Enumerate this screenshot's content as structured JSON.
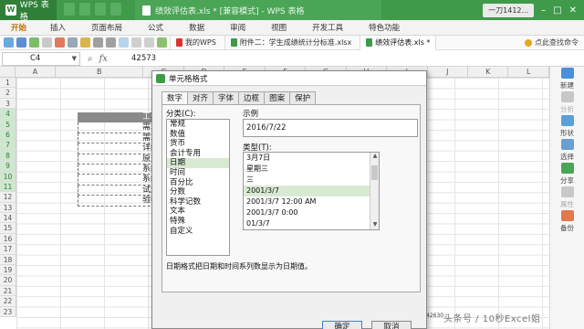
{
  "titlebar": {
    "app_name": "WPS 表格",
    "doc_title": "绩效评估表.xls * [兼容模式] - WPS 表格",
    "user": "一刀1412..."
  },
  "ribbon": {
    "tabs": [
      "开始",
      "插入",
      "页面布局",
      "公式",
      "数据",
      "审阅",
      "视图",
      "开发工具",
      "特色功能"
    ]
  },
  "doc_tabs": [
    {
      "label": "我的WPS"
    },
    {
      "label": "附件二：学生成绩统计分标准.xlsx"
    },
    {
      "label": "绩效评估表.xls *"
    }
  ],
  "search_hint": "点此查找命令",
  "formula": {
    "cell_ref": "C4",
    "value": "42573"
  },
  "columns": [
    "A",
    "B",
    "C",
    "D",
    "E",
    "F",
    "G",
    "H",
    "I",
    "J",
    "K",
    "L"
  ],
  "rows": [
    "1",
    "2",
    "3",
    "4",
    "5",
    "6",
    "7",
    "8",
    "9",
    "10",
    "11",
    "12",
    "13",
    "14",
    "15",
    "16",
    "17",
    "18",
    "19",
    "20",
    "21",
    "22",
    "23"
  ],
  "sheet": {
    "header_text": "工作任",
    "cells": [
      "需求调",
      "需求分",
      "详细分",
      "原型制",
      "系统开",
      "系统测",
      "试运行",
      "验收及"
    ],
    "stray_value": "42630"
  },
  "taskpane": {
    "items": [
      "新建",
      "分析",
      "形状",
      "选择",
      "分享",
      "属性",
      "备份"
    ]
  },
  "dialog": {
    "title": "单元格格式",
    "tabs": [
      "数字",
      "对齐",
      "字体",
      "边框",
      "图案",
      "保护"
    ],
    "category_label": "分类(C):",
    "categories": [
      "常规",
      "数值",
      "货币",
      "会计专用",
      "日期",
      "时间",
      "百分比",
      "分数",
      "科学记数",
      "文本",
      "特殊",
      "自定义"
    ],
    "selected_category": "日期",
    "sample_label": "示例",
    "sample_value": "2016/7/22",
    "type_label": "类型(T):",
    "types": [
      "3月7日",
      "星期三",
      "三",
      "2001/3/7",
      "2001/3/7 12:00 AM",
      "2001/3/7 0:00",
      "01/3/7"
    ],
    "selected_type": "2001/3/7",
    "description": "日期格式把日期和时间系列数显示为日期值。",
    "ok_label": "确定",
    "cancel_label": "取消"
  },
  "watermark": "头条号 / 10秒Excel姐",
  "colors": {
    "brand_green": "#3f9a4a",
    "selection_green": "#d9ead3"
  }
}
